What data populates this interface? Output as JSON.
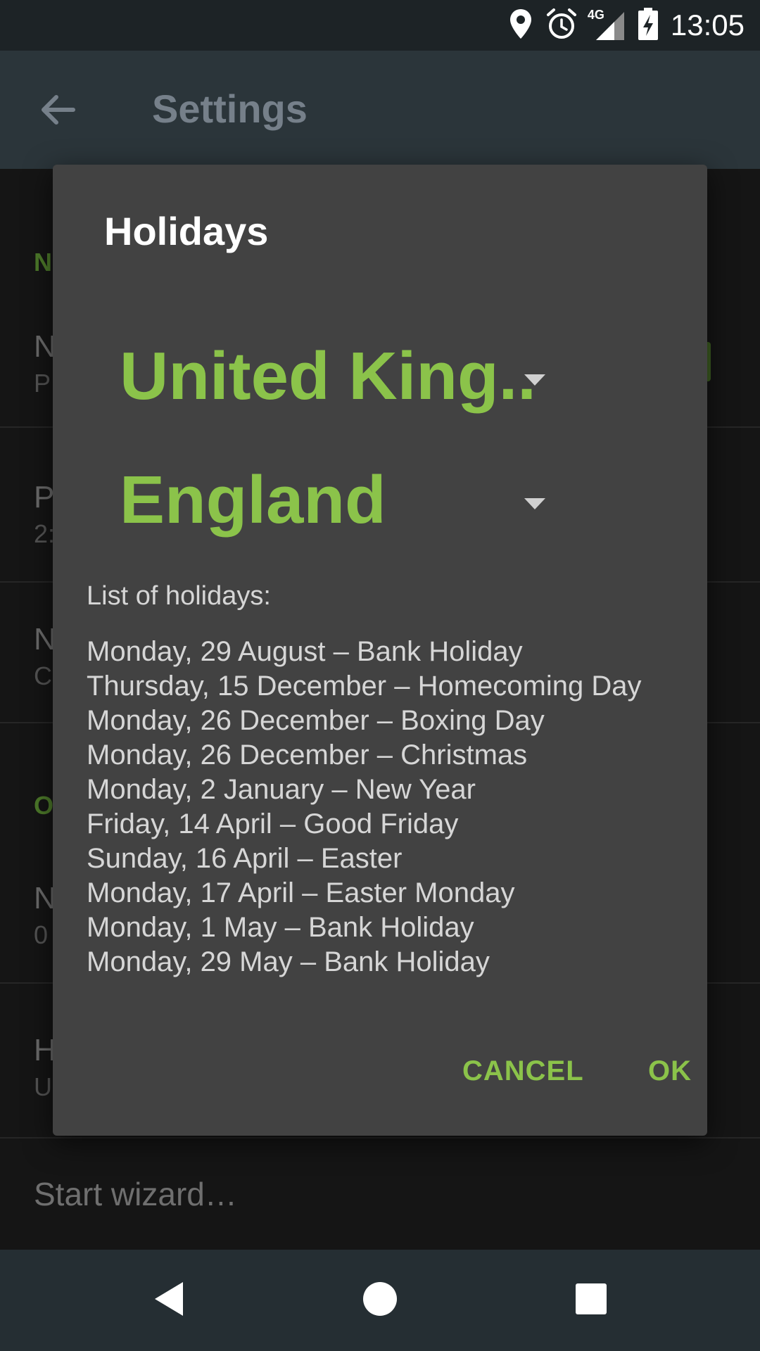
{
  "status_bar": {
    "time": "13:05",
    "network": "4G",
    "icons": [
      "location-icon",
      "alarm-icon",
      "signal-icon",
      "battery-charging-icon"
    ]
  },
  "app_bar": {
    "title": "Settings",
    "back_icon": "arrow-back-icon"
  },
  "background_list": {
    "items": [
      {
        "title": "N",
        "sub": "P"
      },
      {
        "title": "P",
        "sub": "2:"
      },
      {
        "title": "N",
        "sub": "C"
      },
      {
        "title": "N",
        "sub": "0"
      },
      {
        "title": "H",
        "sub": "U"
      }
    ],
    "section_headers": [
      "N",
      "O"
    ],
    "start_wizard": "Start wizard…"
  },
  "dialog": {
    "title": "Holidays",
    "country": "United King..",
    "region": "England",
    "list_label": "List of holidays:",
    "holidays": [
      "Monday, 29 August – Bank Holiday",
      "Thursday, 15 December – Homecoming Day",
      "Monday, 26 December – Boxing Day",
      "Monday, 26 December – Christmas",
      "Monday, 2 January – New Year",
      "Friday, 14 April – Good Friday",
      "Sunday, 16 April – Easter",
      "Monday, 17 April – Easter Monday",
      "Monday, 1 May – Bank Holiday",
      "Monday, 29 May – Bank Holiday"
    ],
    "cancel_label": "CANCEL",
    "ok_label": "OK"
  },
  "nav_bar": {
    "icons": [
      "nav-back-icon",
      "nav-home-icon",
      "nav-recents-icon"
    ]
  },
  "colors": {
    "accent": "#8bc34a",
    "dialog_bg": "#424242",
    "status_bar": "#1d2326",
    "app_bar": "#2b353a",
    "nav_bar": "#252e33"
  }
}
